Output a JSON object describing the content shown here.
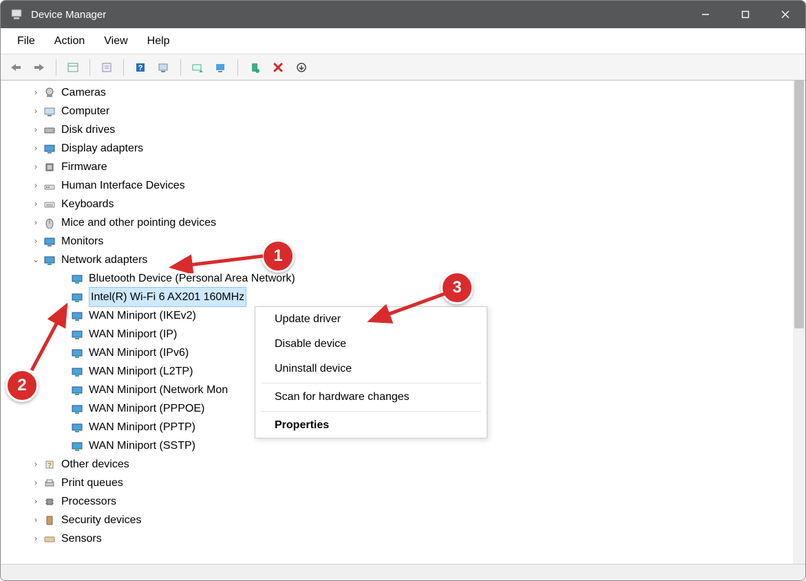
{
  "title": "Device Manager",
  "menu": {
    "file": "File",
    "action": "Action",
    "view": "View",
    "help": "Help"
  },
  "tree": {
    "cameras": "Cameras",
    "computer": "Computer",
    "disks": "Disk drives",
    "display": "Display adapters",
    "firmware": "Firmware",
    "hid": "Human Interface Devices",
    "keyboards": "Keyboards",
    "mice": "Mice and other pointing devices",
    "monitors": "Monitors",
    "network": "Network adapters",
    "net_children": {
      "bt": "Bluetooth Device (Personal Area Network)",
      "wifi": "Intel(R) Wi-Fi 6 AX201 160MHz",
      "ikev2": "WAN Miniport (IKEv2)",
      "ip": "WAN Miniport (IP)",
      "ipv6": "WAN Miniport (IPv6)",
      "l2tp": "WAN Miniport (L2TP)",
      "netmon": "WAN Miniport (Network Mon",
      "pppoe": "WAN Miniport (PPPOE)",
      "pptp": "WAN Miniport (PPTP)",
      "sstp": "WAN Miniport (SSTP)"
    },
    "other": "Other devices",
    "printq": "Print queues",
    "proc": "Processors",
    "security": "Security devices",
    "sensors": "Sensors"
  },
  "ctx": {
    "update": "Update driver",
    "disable": "Disable device",
    "uninstall": "Uninstall device",
    "scan": "Scan for hardware changes",
    "props": "Properties"
  },
  "badges": {
    "b1": "1",
    "b2": "2",
    "b3": "3"
  }
}
